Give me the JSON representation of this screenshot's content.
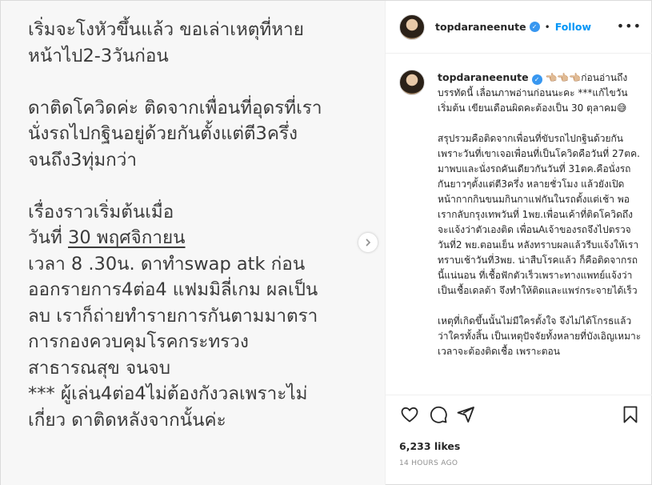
{
  "image": {
    "lines_a": [
      "เริ่มจะโงหัวขึ้นแล้ว ขอเล่าเหตุที่หาย",
      "หน้าไป2-3วันก่อน"
    ],
    "lines_b": [
      "ดาติดโควิดค่ะ ติดจากเพื่อนที่อุดรที่เรา",
      "นั่งรถไปกฐินอยู่ด้วยกันตั้งแต่ตี3ครึ่ง",
      "จนถึง3ทุ่มกว่า"
    ],
    "line_c1": "เรื่องราวเริ่มต้นเมื่อ",
    "line_c2_prefix": "วันที่ ",
    "line_c2_underlined": "30 พฤศจิกายน",
    "lines_c": [
      "เวลา 8 .30น. ดาทำswap atk ก่อน",
      "ออกรายการ4ต่อ4 แฟมมิลี่เกม ผลเป็น",
      "ลบ เราก็ถ่ายทำรายการกันตามมาตรา",
      "การกองควบคุมโรคกระทรวง",
      "สาธารณสุข จนจบ",
      "*** ผู้เล่น4ต่อ4ไม่ต้องกังวลเพราะไม่",
      "เกี่ยว ดาติดหลังจากนั้นค่ะ"
    ]
  },
  "header": {
    "username": "topdaraneenute",
    "verified_mark": "✓",
    "dot": "•",
    "follow": "Follow",
    "more": "•••"
  },
  "caption": {
    "username": "topdaraneenute",
    "emoji": "👈🏼👈🏼👈🏼",
    "p1": "ก่อนอ่านถึงบรรทัดนี้ เลื่อนภาพอ่านก่อนนะคะ ***แก้ไขวันเริ่มต้น เขียนเดือนผิดคะต้องเป็น 30 ตุลาคม😅",
    "p2": "สรุปรวมคือติดจากเพื่อนที่ขับรถไปกฐินด้วยกัน เพราะวันที่เขาเจอเพื่อนที่เป็นโควิดคือวันที่ 27ตค. มาพบและนั่งรถคันเดียวกันวันที่ 31ตค.คือนั่งรถกันยาวๆตั้งแต่ตี3ครึ่ง หลายชั่วโมง แล้วยังเปิดหน้ากากกินขนมกินกาแฟกันในรถตั้งแต่เช้า พอเรากลับกรุงเทพวันที่ 1พย.เพื่อนเค้าที่ติดโควิดถึงจะแจ้งว่าตัวเองติด เพื่อนAเจ้าของรถจึงไปตรวจ วันที่2 พย.ตอนเย็น หลังทราบผลแล้วรีบแจ้งให้เราทราบเช้าวันที่3พย. น่าสืบโรคแล้ว ก็คือติดจากรถนี้แน่นอน ที่เชื้อฟักตัวเร็วเพราะทางแพทย์แจ้งว่าเป็นเชื้อเดลต้า จึงทำให้ติดและแพร่กระจายได้เร็ว",
    "p3": "เหตุที่เกิดขึ้นนั้นไม่มีใครตั้งใจ จึงไม่ได้โกรธแล้วว่าใครทั้งสิ้น เป็นเหตุปัจจัยทั้งหลายที่บังเอิญเหมาะเวลาจะต้องติดเชื้อ เพราะตอน"
  },
  "footer": {
    "likes": "6,233 likes",
    "time": "14 HOURS AGO"
  },
  "icons": [
    "heart-icon",
    "comment-icon",
    "share-icon",
    "bookmark-icon",
    "chevron-right-icon",
    "verified-icon",
    "more-icon"
  ],
  "colors": {
    "follow": "#0095f6",
    "verified": "#3897f0",
    "muted": "#8e8e8e",
    "text": "#262626"
  }
}
